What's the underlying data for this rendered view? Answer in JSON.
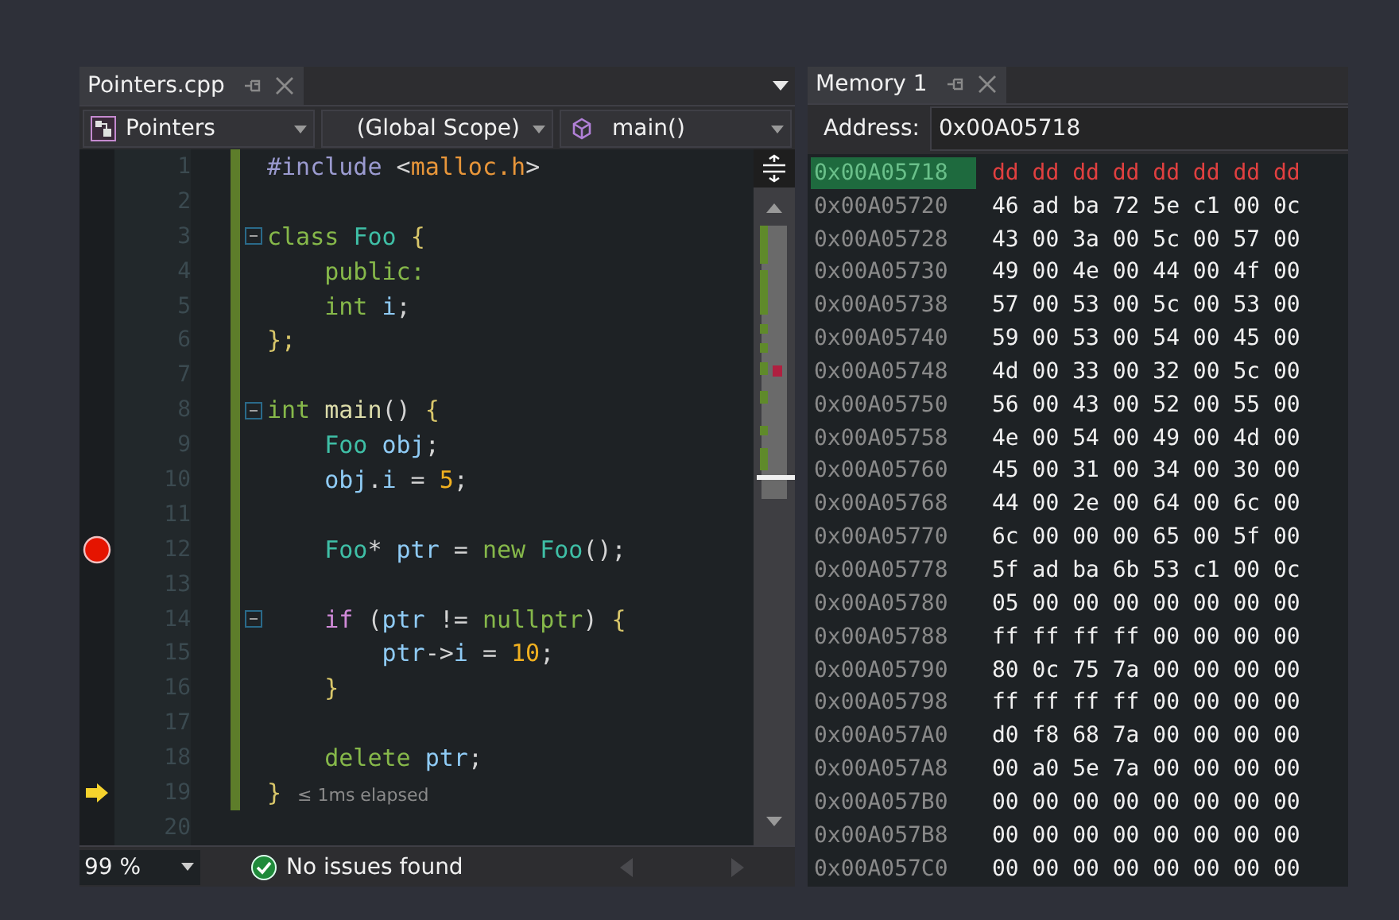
{
  "editor": {
    "tab": {
      "title": "Pointers.cpp"
    },
    "dropdowns": [
      {
        "label": "Pointers",
        "kind": "project"
      },
      {
        "label": "(Global Scope)",
        "kind": "scope"
      },
      {
        "label": "main()",
        "kind": "method"
      }
    ],
    "lines": [
      {
        "number": "1",
        "modified": true,
        "fold": false,
        "breakpoint": false,
        "current": false,
        "tokens": [
          {
            "t": "#include ",
            "kind": "pp"
          },
          {
            "t": "<",
            "kind": "op"
          },
          {
            "t": "malloc.h",
            "kind": "str"
          },
          {
            "t": ">",
            "kind": "op"
          }
        ]
      },
      {
        "number": "2",
        "modified": true,
        "fold": false,
        "breakpoint": false,
        "current": false
      },
      {
        "number": "3",
        "modified": true,
        "fold": true,
        "breakpoint": false,
        "current": false,
        "tokens": [
          {
            "t": "class ",
            "kind": "kw"
          },
          {
            "t": "Foo ",
            "kind": "type"
          },
          {
            "t": "{",
            "kind": "punc"
          }
        ]
      },
      {
        "number": "4",
        "modified": true,
        "fold": false,
        "breakpoint": false,
        "current": false,
        "tokens": [
          {
            "t": "    public:",
            "kind": "kw"
          }
        ]
      },
      {
        "number": "5",
        "modified": true,
        "fold": false,
        "breakpoint": false,
        "current": false,
        "tokens": [
          {
            "t": "    int ",
            "kind": "kw"
          },
          {
            "t": "i",
            "kind": "var"
          },
          {
            "t": ";",
            "kind": "op"
          }
        ]
      },
      {
        "number": "6",
        "modified": true,
        "fold": false,
        "breakpoint": false,
        "current": false,
        "tokens": [
          {
            "t": "};",
            "kind": "punc"
          }
        ]
      },
      {
        "number": "7",
        "modified": true,
        "fold": false,
        "breakpoint": false,
        "current": false
      },
      {
        "number": "8",
        "modified": true,
        "fold": true,
        "breakpoint": false,
        "current": false,
        "tokens": [
          {
            "t": "int ",
            "kind": "kw"
          },
          {
            "t": "main",
            "kind": "fn"
          },
          {
            "t": "() ",
            "kind": "op"
          },
          {
            "t": "{",
            "kind": "punc"
          }
        ]
      },
      {
        "number": "9",
        "modified": true,
        "fold": false,
        "breakpoint": false,
        "current": false,
        "tokens": [
          {
            "t": "    Foo ",
            "kind": "type"
          },
          {
            "t": "obj",
            "kind": "var"
          },
          {
            "t": ";",
            "kind": "op"
          }
        ]
      },
      {
        "number": "10",
        "modified": true,
        "fold": false,
        "breakpoint": false,
        "current": false,
        "tokens": [
          {
            "t": "    obj",
            "kind": "var"
          },
          {
            "t": ".",
            "kind": "op"
          },
          {
            "t": "i",
            "kind": "var"
          },
          {
            "t": " = ",
            "kind": "op"
          },
          {
            "t": "5",
            "kind": "num"
          },
          {
            "t": ";",
            "kind": "op"
          }
        ]
      },
      {
        "number": "11",
        "modified": true,
        "fold": false,
        "breakpoint": false,
        "current": false
      },
      {
        "number": "12",
        "modified": true,
        "fold": false,
        "breakpoint": true,
        "current": false,
        "tokens": [
          {
            "t": "    Foo",
            "kind": "type"
          },
          {
            "t": "* ",
            "kind": "op"
          },
          {
            "t": "ptr",
            "kind": "var"
          },
          {
            "t": " = ",
            "kind": "op"
          },
          {
            "t": "new ",
            "kind": "kw"
          },
          {
            "t": "Foo",
            "kind": "type"
          },
          {
            "t": "();",
            "kind": "op"
          }
        ]
      },
      {
        "number": "13",
        "modified": true,
        "fold": false,
        "breakpoint": false,
        "current": false
      },
      {
        "number": "14",
        "modified": true,
        "fold": true,
        "breakpoint": false,
        "current": false,
        "tokens": [
          {
            "t": "    if",
            "kind": "ctl"
          },
          {
            "t": " (",
            "kind": "op"
          },
          {
            "t": "ptr",
            "kind": "var"
          },
          {
            "t": " != ",
            "kind": "op"
          },
          {
            "t": "nullptr",
            "kind": "kw"
          },
          {
            "t": ") ",
            "kind": "op"
          },
          {
            "t": "{",
            "kind": "punc"
          }
        ]
      },
      {
        "number": "15",
        "modified": true,
        "fold": false,
        "breakpoint": false,
        "current": false,
        "tokens": [
          {
            "t": "        ptr",
            "kind": "var"
          },
          {
            "t": "->",
            "kind": "op"
          },
          {
            "t": "i",
            "kind": "var"
          },
          {
            "t": " = ",
            "kind": "op"
          },
          {
            "t": "10",
            "kind": "num"
          },
          {
            "t": ";",
            "kind": "op"
          }
        ]
      },
      {
        "number": "16",
        "modified": true,
        "fold": false,
        "breakpoint": false,
        "current": false,
        "tokens": [
          {
            "t": "    }",
            "kind": "punc"
          }
        ]
      },
      {
        "number": "17",
        "modified": true,
        "fold": false,
        "breakpoint": false,
        "current": false
      },
      {
        "number": "18",
        "modified": true,
        "fold": false,
        "breakpoint": false,
        "current": false,
        "tokens": [
          {
            "t": "    delete ",
            "kind": "kw"
          },
          {
            "t": "ptr",
            "kind": "var"
          },
          {
            "t": ";",
            "kind": "op"
          }
        ]
      },
      {
        "number": "19",
        "modified": true,
        "fold": false,
        "breakpoint": false,
        "current": true,
        "tokens": [
          {
            "t": "}",
            "kind": "punc"
          }
        ],
        "hint": "≤ 1ms elapsed"
      },
      {
        "number": "20",
        "modified": false,
        "fold": false,
        "breakpoint": false,
        "current": false
      }
    ],
    "status": {
      "zoom": "99 %",
      "message": "No issues found"
    }
  },
  "memory": {
    "tab": {
      "title": "Memory 1"
    },
    "address_label": "Address:",
    "address_value": "0x00A05718",
    "rows": [
      {
        "address": "0x00A05718",
        "bytes": "dd dd dd dd dd dd dd dd",
        "selected": true,
        "changed": true
      },
      {
        "address": "0x00A05720",
        "bytes": "46 ad ba 72 5e c1 00 0c",
        "selected": false,
        "changed": false
      },
      {
        "address": "0x00A05728",
        "bytes": "43 00 3a 00 5c 00 57 00",
        "selected": false,
        "changed": false
      },
      {
        "address": "0x00A05730",
        "bytes": "49 00 4e 00 44 00 4f 00",
        "selected": false,
        "changed": false
      },
      {
        "address": "0x00A05738",
        "bytes": "57 00 53 00 5c 00 53 00",
        "selected": false,
        "changed": false
      },
      {
        "address": "0x00A05740",
        "bytes": "59 00 53 00 54 00 45 00",
        "selected": false,
        "changed": false
      },
      {
        "address": "0x00A05748",
        "bytes": "4d 00 33 00 32 00 5c 00",
        "selected": false,
        "changed": false
      },
      {
        "address": "0x00A05750",
        "bytes": "56 00 43 00 52 00 55 00",
        "selected": false,
        "changed": false
      },
      {
        "address": "0x00A05758",
        "bytes": "4e 00 54 00 49 00 4d 00",
        "selected": false,
        "changed": false
      },
      {
        "address": "0x00A05760",
        "bytes": "45 00 31 00 34 00 30 00",
        "selected": false,
        "changed": false
      },
      {
        "address": "0x00A05768",
        "bytes": "44 00 2e 00 64 00 6c 00",
        "selected": false,
        "changed": false
      },
      {
        "address": "0x00A05770",
        "bytes": "6c 00 00 00 65 00 5f 00",
        "selected": false,
        "changed": false
      },
      {
        "address": "0x00A05778",
        "bytes": "5f ad ba 6b 53 c1 00 0c",
        "selected": false,
        "changed": false
      },
      {
        "address": "0x00A05780",
        "bytes": "05 00 00 00 00 00 00 00",
        "selected": false,
        "changed": false
      },
      {
        "address": "0x00A05788",
        "bytes": "ff ff ff ff 00 00 00 00",
        "selected": false,
        "changed": false
      },
      {
        "address": "0x00A05790",
        "bytes": "80 0c 75 7a 00 00 00 00",
        "selected": false,
        "changed": false
      },
      {
        "address": "0x00A05798",
        "bytes": "ff ff ff ff 00 00 00 00",
        "selected": false,
        "changed": false
      },
      {
        "address": "0x00A057A0",
        "bytes": "d0 f8 68 7a 00 00 00 00",
        "selected": false,
        "changed": false
      },
      {
        "address": "0x00A057A8",
        "bytes": "00 a0 5e 7a 00 00 00 00",
        "selected": false,
        "changed": false
      },
      {
        "address": "0x00A057B0",
        "bytes": "00 00 00 00 00 00 00 00",
        "selected": false,
        "changed": false
      },
      {
        "address": "0x00A057B8",
        "bytes": "00 00 00 00 00 00 00 00",
        "selected": false,
        "changed": false
      },
      {
        "address": "0x00A057C0",
        "bytes": "00 00 00 00 00 00 00 00",
        "selected": false,
        "changed": false
      }
    ]
  }
}
